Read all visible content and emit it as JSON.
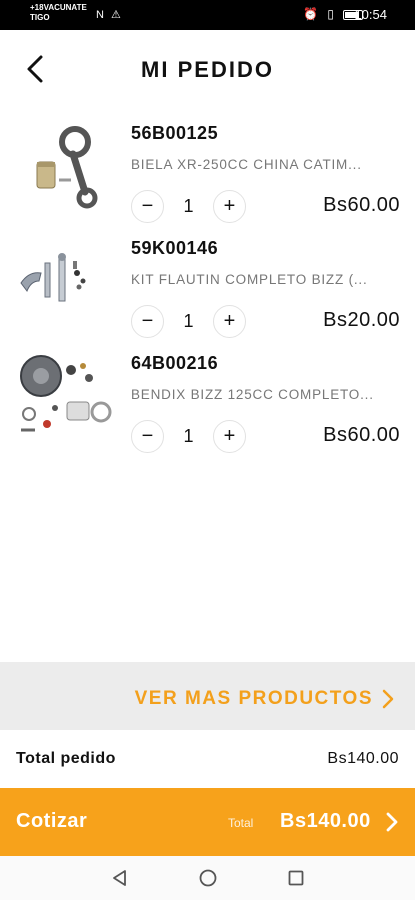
{
  "status_bar": {
    "carrier": "+18VACUNATE TIGO",
    "time": "10:54",
    "icons_left": "N ⚠",
    "icons_right": "⏰ ▯"
  },
  "header": {
    "title": "MI PEDIDO",
    "back_icon": "chevron-left-icon"
  },
  "cart": {
    "items": [
      {
        "code": "56B00125",
        "description": "BIELA XR-250CC CHINA CATIM...",
        "quantity": "1",
        "price": "Bs60.00",
        "minus": "−",
        "plus": "+"
      },
      {
        "code": "59K00146",
        "description": "KIT FLAUTIN COMPLETO BIZZ (...",
        "quantity": "1",
        "price": "Bs20.00",
        "minus": "−",
        "plus": "+"
      },
      {
        "code": "64B00216",
        "description": "BENDIX BIZZ 125CC COMPLETO...",
        "quantity": "1",
        "price": "Bs60.00",
        "minus": "−",
        "plus": "+"
      }
    ]
  },
  "more_products": {
    "label": "VER MAS PRODUCTOS"
  },
  "summary": {
    "label": "Total pedido",
    "value": "Bs140.00"
  },
  "quote": {
    "label": "Cotizar",
    "total_label": "Total",
    "total_value": "Bs140.00"
  },
  "colors": {
    "accent": "#f7a21b",
    "band": "#ececec",
    "muted_text": "#777777"
  },
  "nav": {
    "back_icon": "triangle-back-icon",
    "home_icon": "circle-home-icon",
    "recents_icon": "square-recents-icon"
  }
}
